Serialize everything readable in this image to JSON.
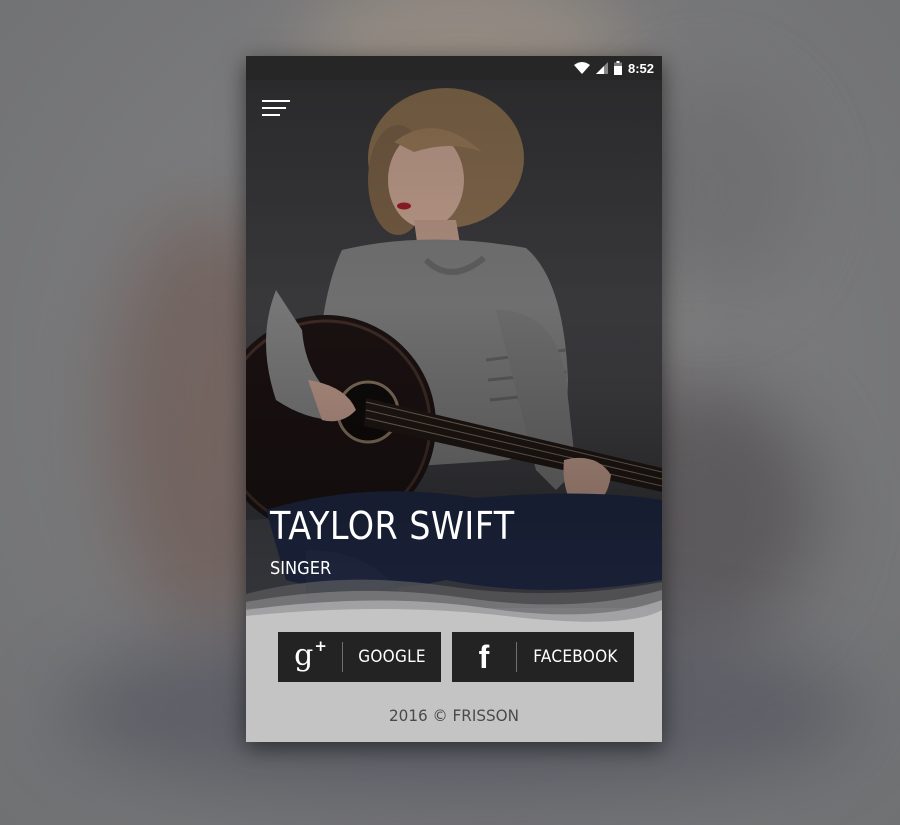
{
  "status_bar": {
    "time": "8:52",
    "icons": [
      "wifi-icon",
      "cell-signal-icon",
      "battery-icon"
    ]
  },
  "header": {
    "menu_icon": "menu-icon"
  },
  "profile": {
    "name": "TAYLOR SWIFT",
    "role": "SINGER"
  },
  "social": {
    "google": {
      "icon": "google-plus-icon",
      "glyph": "g",
      "glyph_plus": "+",
      "label": "GOOGLE"
    },
    "facebook": {
      "icon": "facebook-icon",
      "glyph": "f",
      "label": "FACEBOOK"
    }
  },
  "footer": {
    "copyright": "2016 © FRISSON"
  },
  "colors": {
    "button_bg": "#232323",
    "footer_bg": "#c4c4c4",
    "status_bg": "#262626",
    "text_light": "#ffffff"
  }
}
